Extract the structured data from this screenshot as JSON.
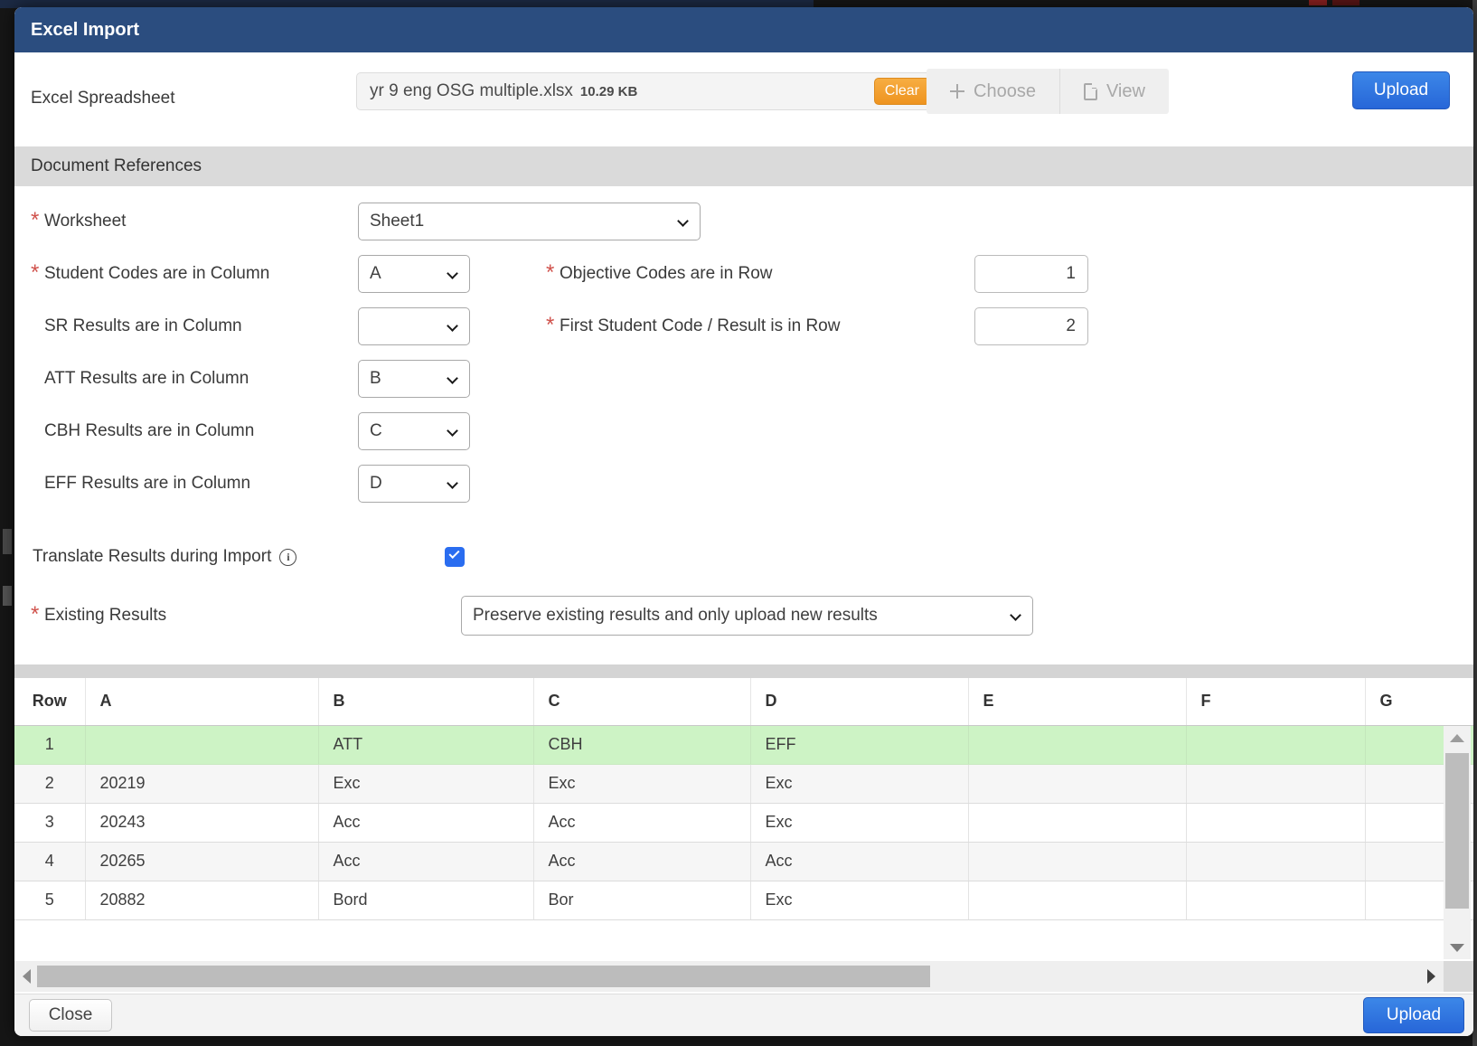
{
  "ui": {
    "required_marker": "*"
  },
  "colors": {
    "header_bar": "#2b4d7f",
    "primary_button_blue": "#2e74e0",
    "clear_button_orange": "#f2a12e",
    "highlight_row_green": "#cdf3c5",
    "checkbox_blue": "#2a6df0"
  },
  "modal": {
    "title": "Excel Import"
  },
  "file_row": {
    "label": "Excel Spreadsheet",
    "filename": "yr 9 eng OSG multiple.xlsx",
    "filesize": "10.29 KB",
    "clear_label": "Clear",
    "choose_label": "Choose",
    "view_label": "View",
    "upload_label": "Upload"
  },
  "section": {
    "title": "Document References"
  },
  "fields": {
    "worksheet": {
      "label": "Worksheet",
      "value": "Sheet1"
    },
    "student_codes_column": {
      "label": "Student Codes are in Column",
      "value": "A"
    },
    "objective_codes_row": {
      "label": "Objective Codes are in Row",
      "value": "1"
    },
    "sr_results_column": {
      "label": "SR Results are in Column",
      "value": ""
    },
    "first_student_row": {
      "label": "First Student Code / Result is in Row",
      "value": "2"
    },
    "att_results_column": {
      "label": "ATT Results are in Column",
      "value": "B"
    },
    "cbh_results_column": {
      "label": "CBH Results are in Column",
      "value": "C"
    },
    "eff_results_column": {
      "label": "EFF Results are in Column",
      "value": "D"
    },
    "translate_results": {
      "label": "Translate Results during Import",
      "checked": true
    },
    "existing_results": {
      "label": "Existing Results",
      "value": "Preserve existing results and only upload new results"
    }
  },
  "preview_table": {
    "headers": [
      "Row",
      "A",
      "B",
      "C",
      "D",
      "E",
      "F",
      "G"
    ],
    "rows": [
      {
        "row": "1",
        "highlight": true,
        "cells": [
          "",
          "ATT",
          "CBH",
          "EFF",
          "",
          "",
          ""
        ]
      },
      {
        "row": "2",
        "highlight": false,
        "cells": [
          "20219",
          "Exc",
          "Exc",
          "Exc",
          "",
          "",
          ""
        ]
      },
      {
        "row": "3",
        "highlight": false,
        "cells": [
          "20243",
          "Acc",
          "Acc",
          "Exc",
          "",
          "",
          ""
        ]
      },
      {
        "row": "4",
        "highlight": false,
        "cells": [
          "20265",
          "Acc",
          "Acc",
          "Acc",
          "",
          "",
          ""
        ]
      },
      {
        "row": "5",
        "highlight": false,
        "cells": [
          "20882",
          "Bord",
          "Bor",
          "Exc",
          "",
          "",
          ""
        ]
      }
    ]
  },
  "footer": {
    "close_label": "Close",
    "upload_label": "Upload"
  }
}
